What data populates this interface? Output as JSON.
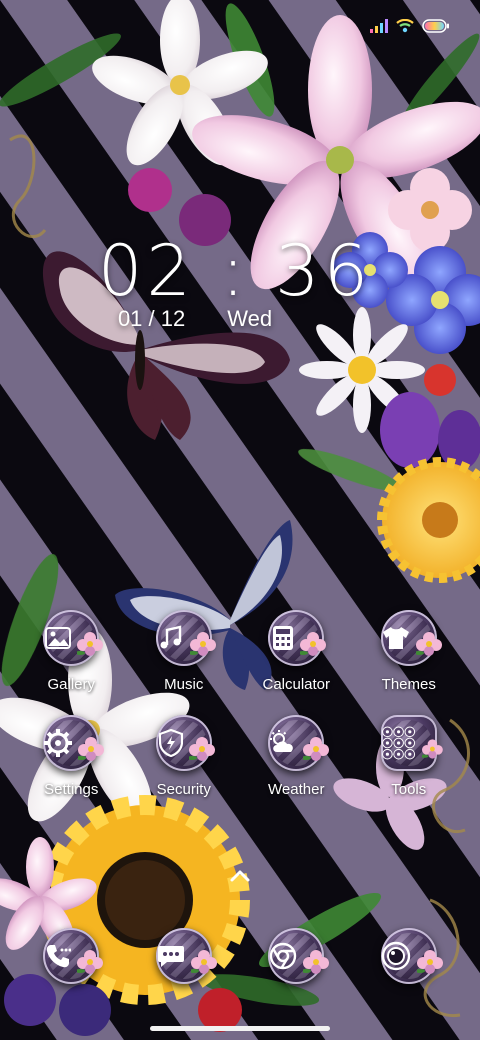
{
  "clock": {
    "time": "02 : 36",
    "date": "01 / 12",
    "weekday": "Wed"
  },
  "status": {
    "icons": [
      "signal-icon",
      "wifi-icon",
      "battery-icon"
    ]
  },
  "apps": [
    {
      "label": "Gallery",
      "icon": "gallery-icon"
    },
    {
      "label": "Music",
      "icon": "music-note-icon"
    },
    {
      "label": "Calculator",
      "icon": "calculator-icon"
    },
    {
      "label": "Themes",
      "icon": "tshirt-icon"
    },
    {
      "label": "Settings",
      "icon": "gear-icon"
    },
    {
      "label": "Security",
      "icon": "shield-icon"
    },
    {
      "label": "Weather",
      "icon": "weather-icon"
    },
    {
      "label": "Tools",
      "icon": "tools-folder-icon"
    }
  ],
  "dock": [
    {
      "icon": "phone-icon"
    },
    {
      "icon": "messages-icon"
    },
    {
      "icon": "browser-icon"
    },
    {
      "icon": "camera-icon"
    }
  ],
  "colors": {
    "stripe_light": "#7d7392",
    "icon_purple": "#4c3a63",
    "petal_pink": "#f3b8d6",
    "text": "#ffffff"
  }
}
